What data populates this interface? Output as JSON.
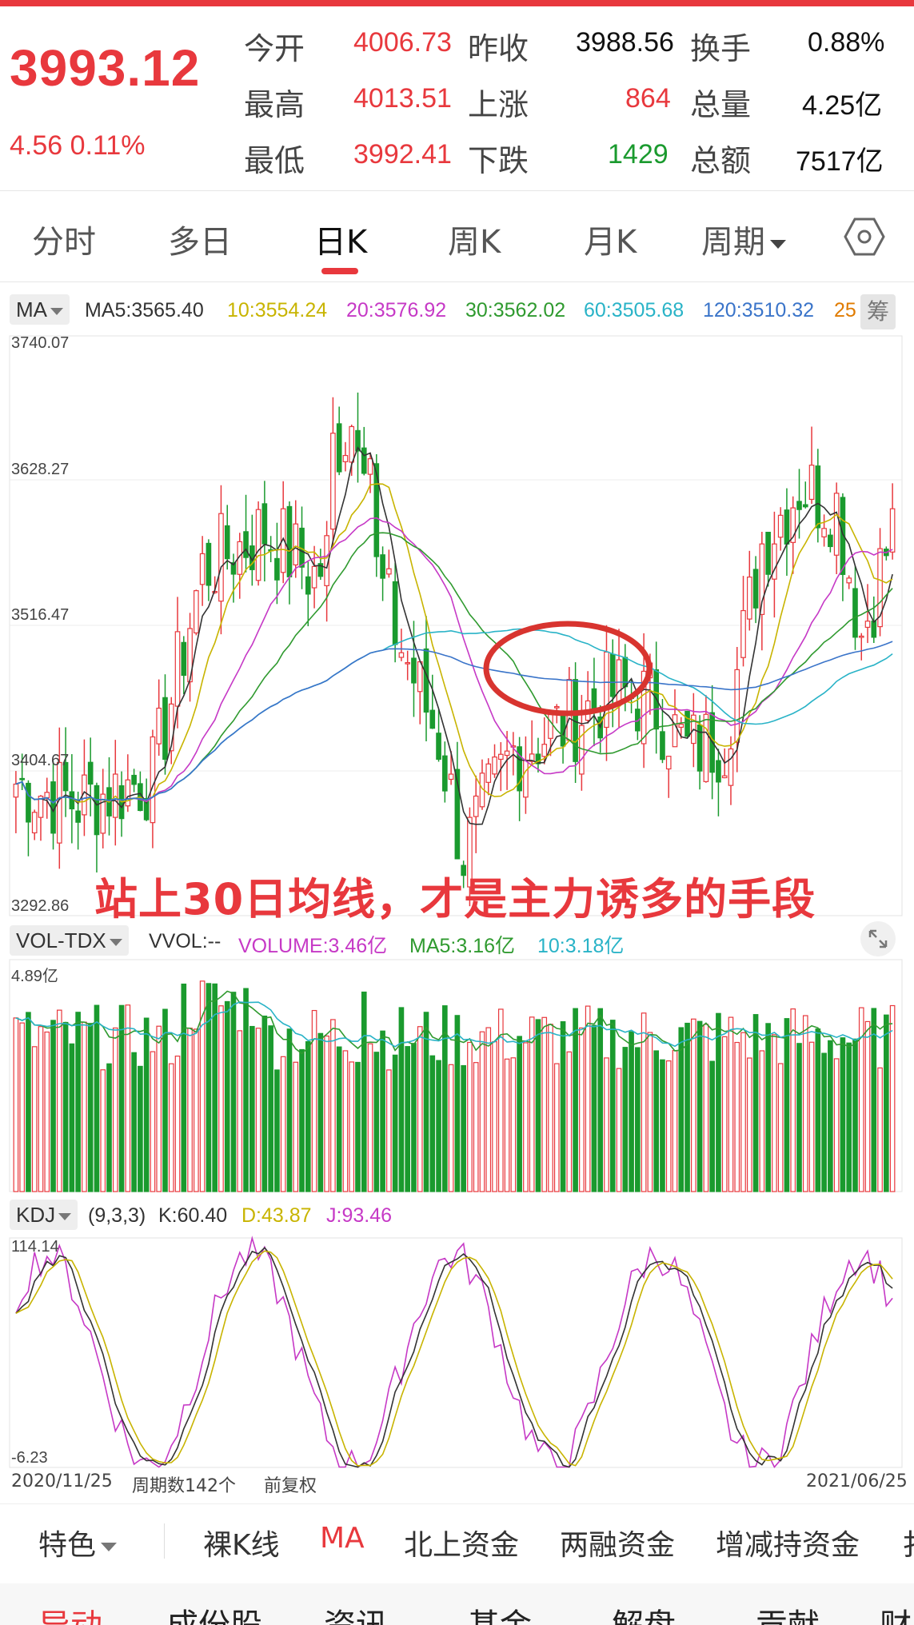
{
  "quote": {
    "price": "3993.12",
    "change": "4.56 0.11%",
    "rows": [
      {
        "l1": "今开",
        "v1": "4006.73",
        "l2": "昨收",
        "v2": "3988.56",
        "l3": "换手",
        "v3": "0.88%"
      },
      {
        "l1": "最高",
        "v1": "4013.51",
        "l2": "上涨",
        "v2": "864",
        "l3": "总量",
        "v3": "4.25亿"
      },
      {
        "l1": "最低",
        "v1": "3992.41",
        "l2": "下跌",
        "v2": "1429",
        "l3": "总额",
        "v3": "7517亿"
      }
    ]
  },
  "tabs": [
    "分时",
    "多日",
    "日K",
    "周K",
    "月K",
    "周期"
  ],
  "active_tab": "日K",
  "ma_legend": {
    "name": "MA",
    "ma5": "MA5:3565.40",
    "ma10": "10:3554.24",
    "ma20": "20:3576.92",
    "ma30": "30:3562.02",
    "ma60": "60:3505.68",
    "ma120": "120:3510.32",
    "ma250": "25",
    "chip": "筹"
  },
  "price_axis": [
    "3740.07",
    "3628.27",
    "3516.47",
    "3404.67",
    "3292.86"
  ],
  "annotation": "站上30日均线，才是主力诱多的手段",
  "vol_legend": {
    "name": "VOL-TDX",
    "vvol": "VVOL:--",
    "volume": "VOLUME:3.46亿",
    "ma5": "MA5:3.16亿",
    "ma10": "10:3.18亿",
    "axis_top": "4.89亿"
  },
  "kdj_legend": {
    "name": "KDJ",
    "params": "(9,3,3)",
    "k": "K:60.40",
    "d": "D:43.87",
    "j": "J:93.46",
    "axis_top": "114.14",
    "axis_bottom": "-6.23"
  },
  "footer": {
    "start_date": "2020/11/25",
    "period_count": "周期数142个",
    "adjust": "前复权",
    "end_date": "2021/06/25"
  },
  "indicator_tabs": [
    "特色",
    "裸K线",
    "MA",
    "北上资金",
    "两融资金",
    "增减持资金",
    "扌"
  ],
  "active_indicator": "MA",
  "bottom_nav": [
    "异动",
    "成份股",
    "资讯",
    "基金",
    "解盘",
    "贡献",
    "财"
  ],
  "colors": {
    "up": "#e8383d",
    "down": "#1a9a2e",
    "ma5": "#333333",
    "ma10": "#c8b400",
    "ma20": "#c639c6",
    "ma30": "#2f9a2f",
    "ma60": "#29b3c7",
    "ma120": "#3a74c9"
  }
}
